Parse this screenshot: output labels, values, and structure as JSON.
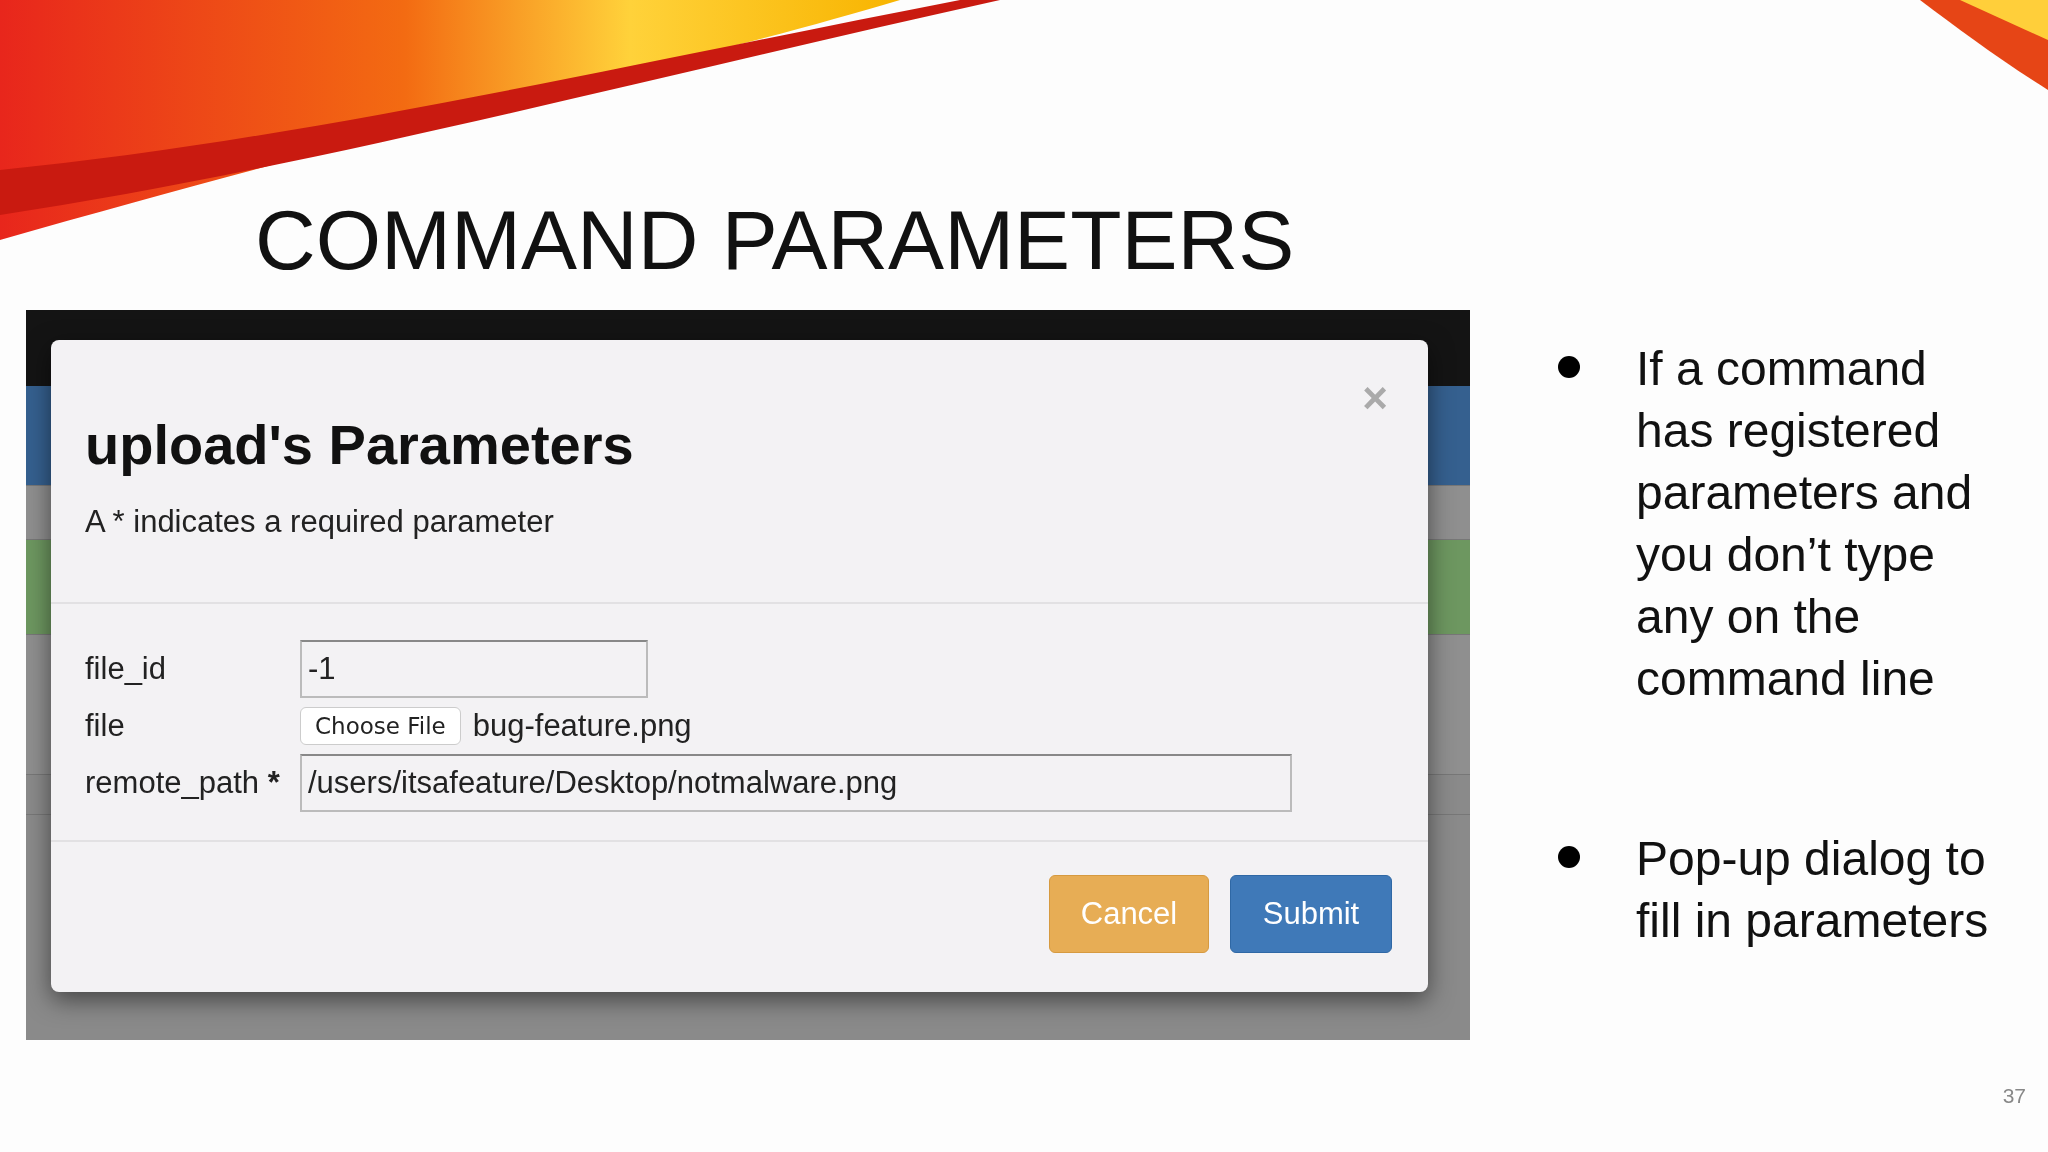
{
  "slide": {
    "title": "COMMAND PARAMETERS",
    "bullets": [
      {
        "text": "If a command has registered parameters and you don’t type any on the command line"
      },
      {
        "text": "Pop-up dialog to fill in parameters"
      }
    ],
    "page_number": "37"
  },
  "screenshot": {
    "dialog": {
      "title": "upload's Parameters",
      "subtitle": "A * indicates a required parameter",
      "close": "×",
      "fields": [
        {
          "kind": "text",
          "label": "file_id",
          "value": "-1"
        },
        {
          "kind": "file",
          "label": "file",
          "button": "Choose File",
          "filename": "bug-feature.png"
        },
        {
          "kind": "long_text",
          "label": "remote_path",
          "required_mark": "*",
          "value": "/users/itsafeature/Desktop/notmalware.png"
        }
      ],
      "buttons": [
        {
          "label": "Cancel",
          "kind": "warning"
        },
        {
          "label": "Submit",
          "kind": "primary"
        }
      ]
    }
  }
}
